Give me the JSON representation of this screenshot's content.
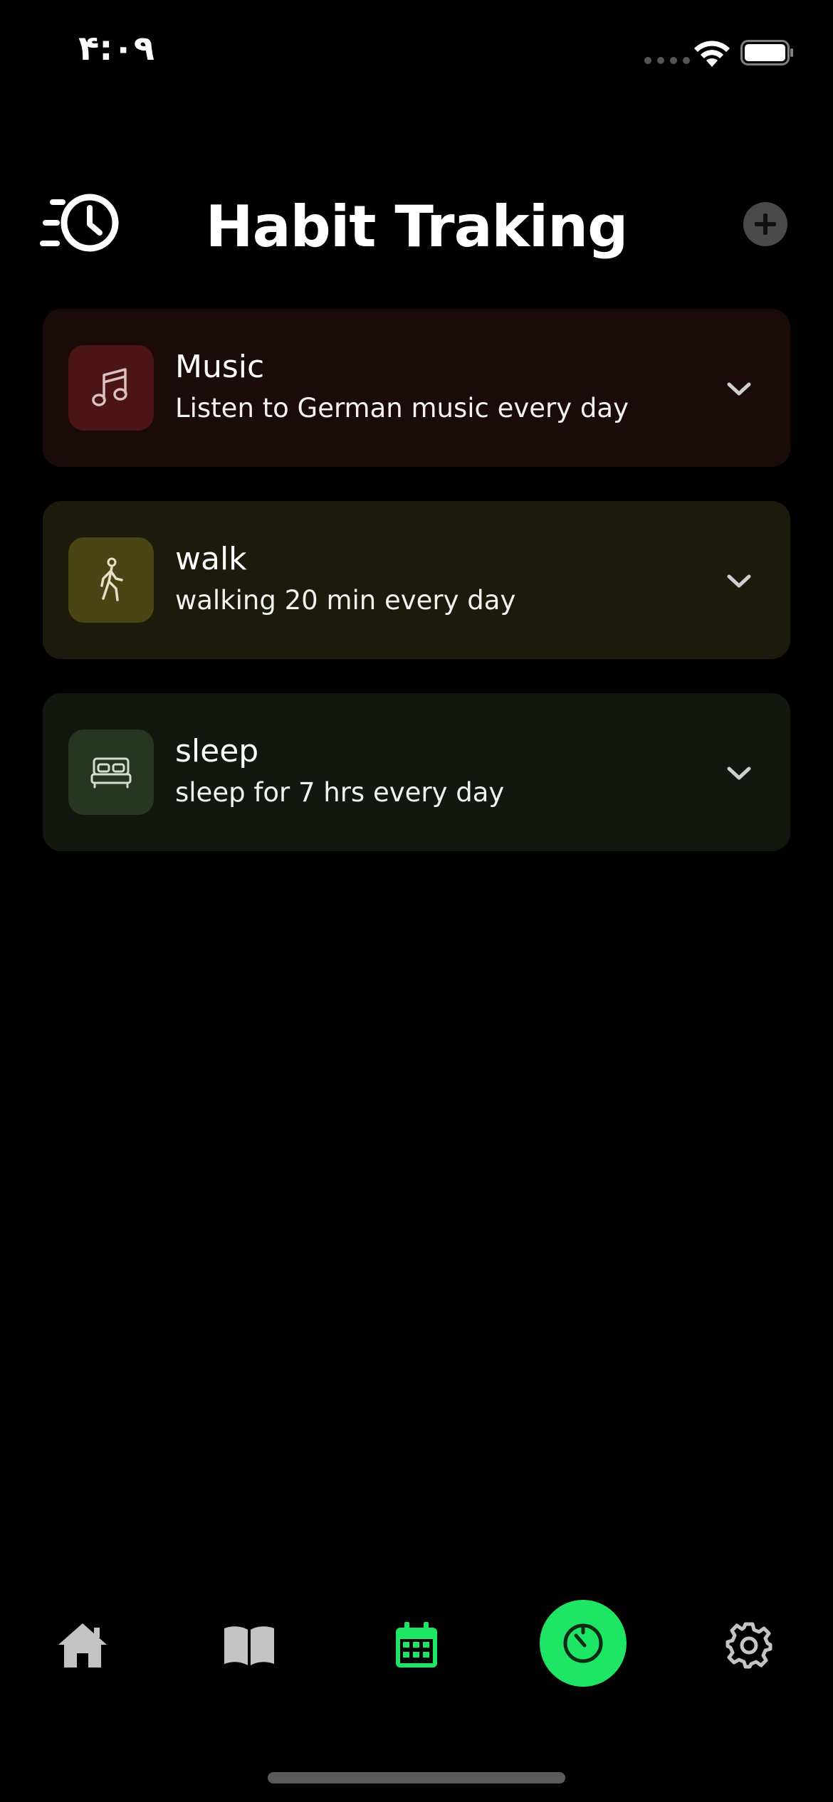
{
  "status_bar": {
    "time": "۴:۰۹"
  },
  "header": {
    "title": "Habit Traking"
  },
  "habits": [
    {
      "name": "Music",
      "description": "Listen to German music every day",
      "icon": "music-note-icon",
      "card_color": "#1b0a0a",
      "icon_bg": "#4a1512"
    },
    {
      "name": "walk",
      "description": "walking 20 min every day",
      "icon": "walking-person-icon",
      "card_color": "#1b1a0b",
      "icon_bg": "#4a4515"
    },
    {
      "name": "sleep",
      "description": "sleep for 7 hrs every day",
      "icon": "bed-icon",
      "card_color": "#121710",
      "icon_bg": "#27361e"
    }
  ],
  "bottom_nav": {
    "items": [
      "home-icon",
      "book-icon",
      "calendar-icon",
      "timer-icon",
      "gear-icon"
    ],
    "active_item": "calendar-icon",
    "accent_color": "#1fe565"
  }
}
